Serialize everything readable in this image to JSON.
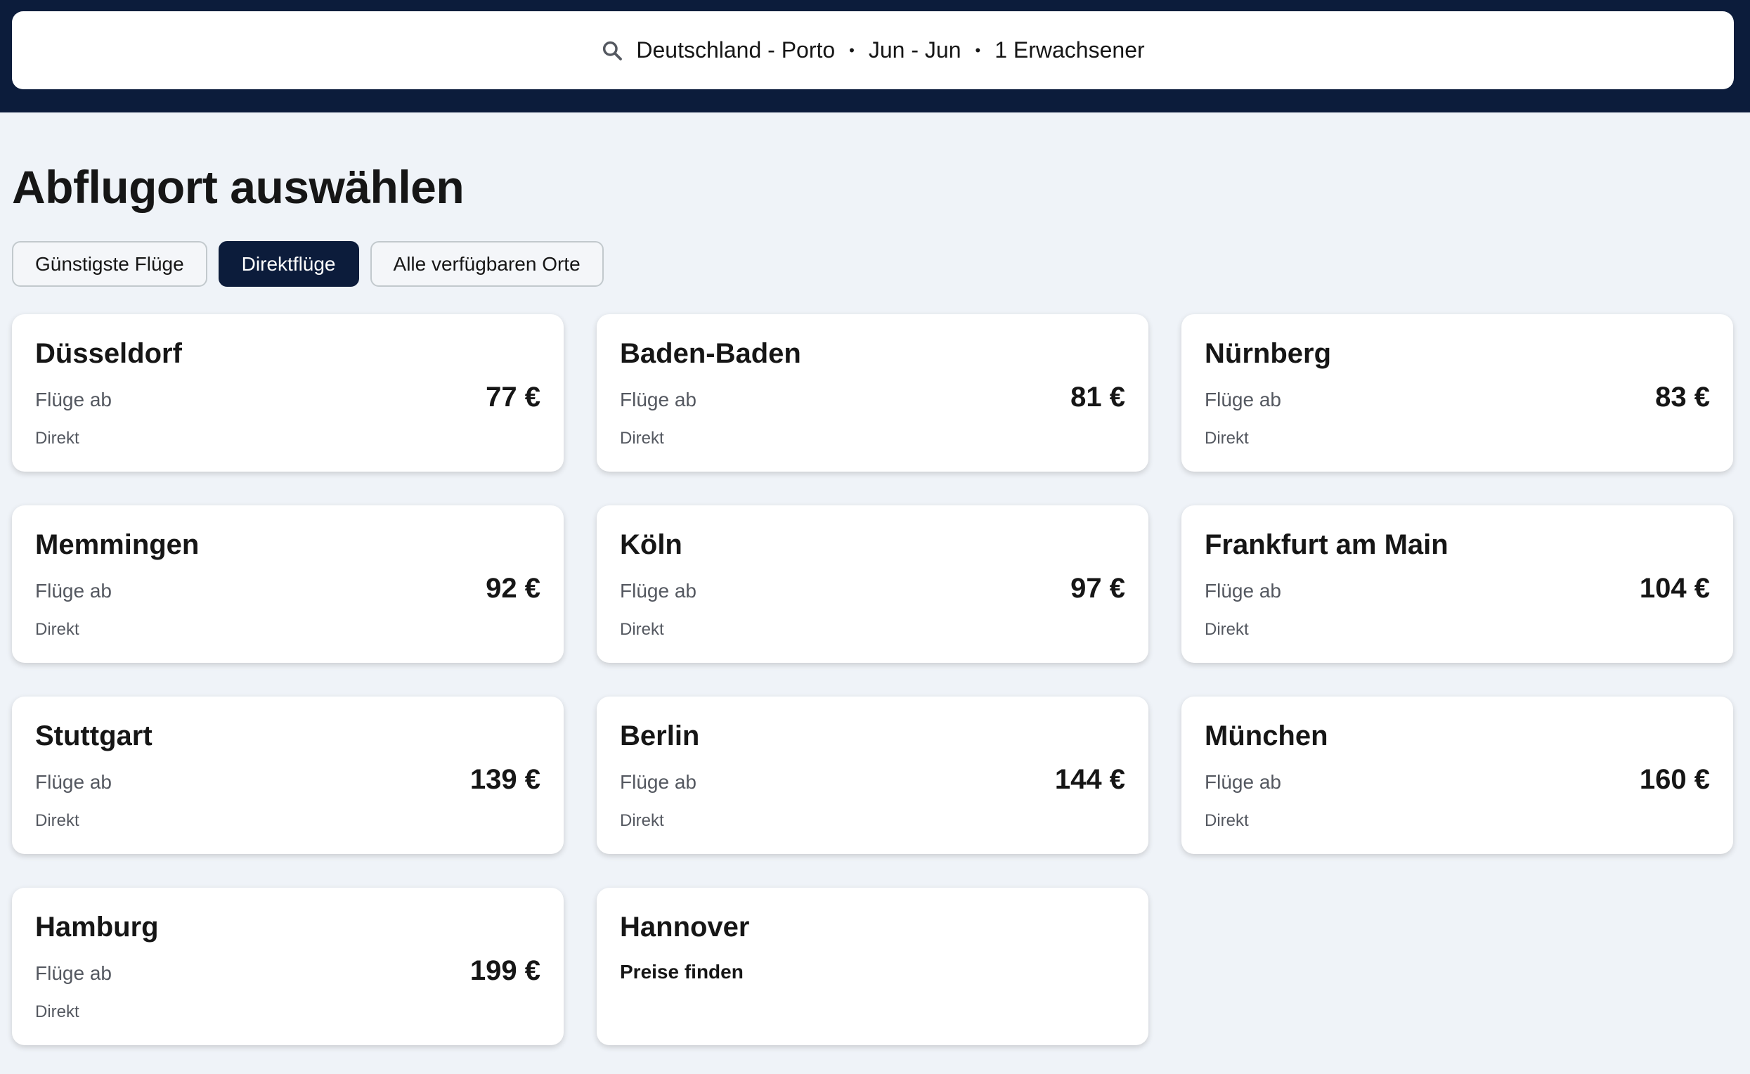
{
  "search": {
    "route": "Deutschland - Porto",
    "dates": "Jun - Jun",
    "travellers": "1 Erwachsener",
    "separator": "•"
  },
  "page": {
    "title": "Abflugort auswählen"
  },
  "filters": [
    {
      "label": "Günstigste Flüge",
      "active": false
    },
    {
      "label": "Direktflüge",
      "active": true
    },
    {
      "label": "Alle verfügbaren Orte",
      "active": false
    }
  ],
  "cards": [
    {
      "city": "Düsseldorf",
      "from": "Flüge ab",
      "price": "77 €",
      "stops": "Direkt"
    },
    {
      "city": "Baden-Baden",
      "from": "Flüge ab",
      "price": "81 €",
      "stops": "Direkt"
    },
    {
      "city": "Nürnberg",
      "from": "Flüge ab",
      "price": "83 €",
      "stops": "Direkt"
    },
    {
      "city": "Memmingen",
      "from": "Flüge ab",
      "price": "92 €",
      "stops": "Direkt"
    },
    {
      "city": "Köln",
      "from": "Flüge ab",
      "price": "97 €",
      "stops": "Direkt"
    },
    {
      "city": "Frankfurt am Main",
      "from": "Flüge ab",
      "price": "104 €",
      "stops": "Direkt"
    },
    {
      "city": "Stuttgart",
      "from": "Flüge ab",
      "price": "139 €",
      "stops": "Direkt"
    },
    {
      "city": "Berlin",
      "from": "Flüge ab",
      "price": "144 €",
      "stops": "Direkt"
    },
    {
      "city": "München",
      "from": "Flüge ab",
      "price": "160 €",
      "stops": "Direkt"
    },
    {
      "city": "Hamburg",
      "from": "Flüge ab",
      "price": "199 €",
      "stops": "Direkt"
    },
    {
      "city": "Hannover",
      "find": "Preise finden"
    }
  ],
  "colors": {
    "header_bg": "#0c1c3b",
    "page_bg": "#eff3f8",
    "active_chip": "#0c1c3b",
    "card_bg": "#ffffff"
  },
  "icons": {
    "search": "search-icon"
  }
}
